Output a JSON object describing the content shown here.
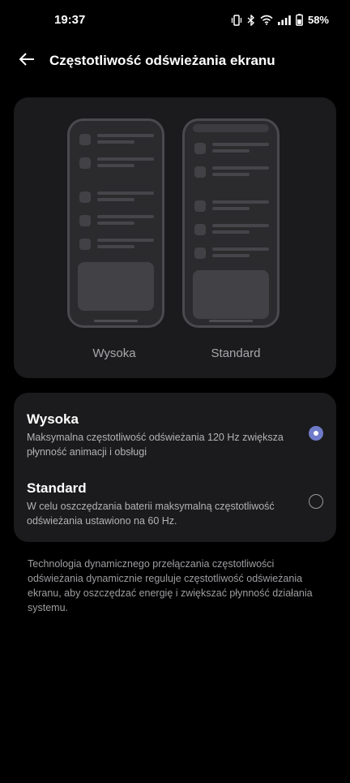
{
  "status_bar": {
    "time": "19:37",
    "battery_percent": "58%",
    "icons": [
      "vibrate-icon",
      "bluetooth-icon",
      "wifi-icon",
      "signal-icon",
      "battery-icon"
    ]
  },
  "header": {
    "back_icon": "arrow-left-icon",
    "title": "Częstotliwość odświeżania ekranu"
  },
  "preview": {
    "left_label": "Wysoka",
    "right_label": "Standard"
  },
  "options": [
    {
      "title": "Wysoka",
      "description": "Maksymalna częstotliwość odświeżania 120 Hz zwiększa płynność animacji i obsługi",
      "selected": true
    },
    {
      "title": "Standard",
      "description": "W celu oszczędzania baterii maksymalną częstotliwość odświeżania ustawiono na 60 Hz.",
      "selected": false
    }
  ],
  "footer": {
    "text": "Technologia dynamicznego przełączania częstotliwości odświeżania dynamicznie reguluje częstotliwość odświeżania ekranu, aby oszczędzać energię i zwiększać płynność działania systemu."
  },
  "colors": {
    "background": "#000000",
    "card": "#1b1b1d",
    "accent": "#6f7bc9"
  }
}
